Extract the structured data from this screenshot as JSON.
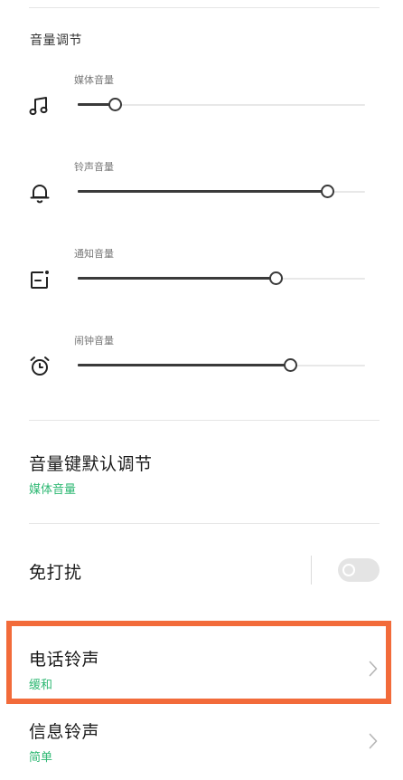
{
  "volume_section": {
    "title": "音量调节",
    "items": [
      {
        "label": "媒体音量",
        "icon": "music-note-icon",
        "level": 0.13
      },
      {
        "label": "铃声音量",
        "icon": "bell-icon",
        "level": 0.87
      },
      {
        "label": "通知音量",
        "icon": "notification-icon",
        "level": 0.69
      },
      {
        "label": "闹钟音量",
        "icon": "alarm-clock-icon",
        "level": 0.74
      }
    ]
  },
  "volume_key_default": {
    "title": "音量键默认调节",
    "value": "媒体音量"
  },
  "do_not_disturb": {
    "title": "免打扰",
    "enabled": false
  },
  "phone_ringtone": {
    "title": "电话铃声",
    "value": "缓和"
  },
  "message_ringtone": {
    "title": "信息铃声",
    "value": "简单"
  },
  "colors": {
    "accent": "#2eb873",
    "highlight_border": "#f26b3a",
    "slider_fill": "#3a3a3a"
  }
}
